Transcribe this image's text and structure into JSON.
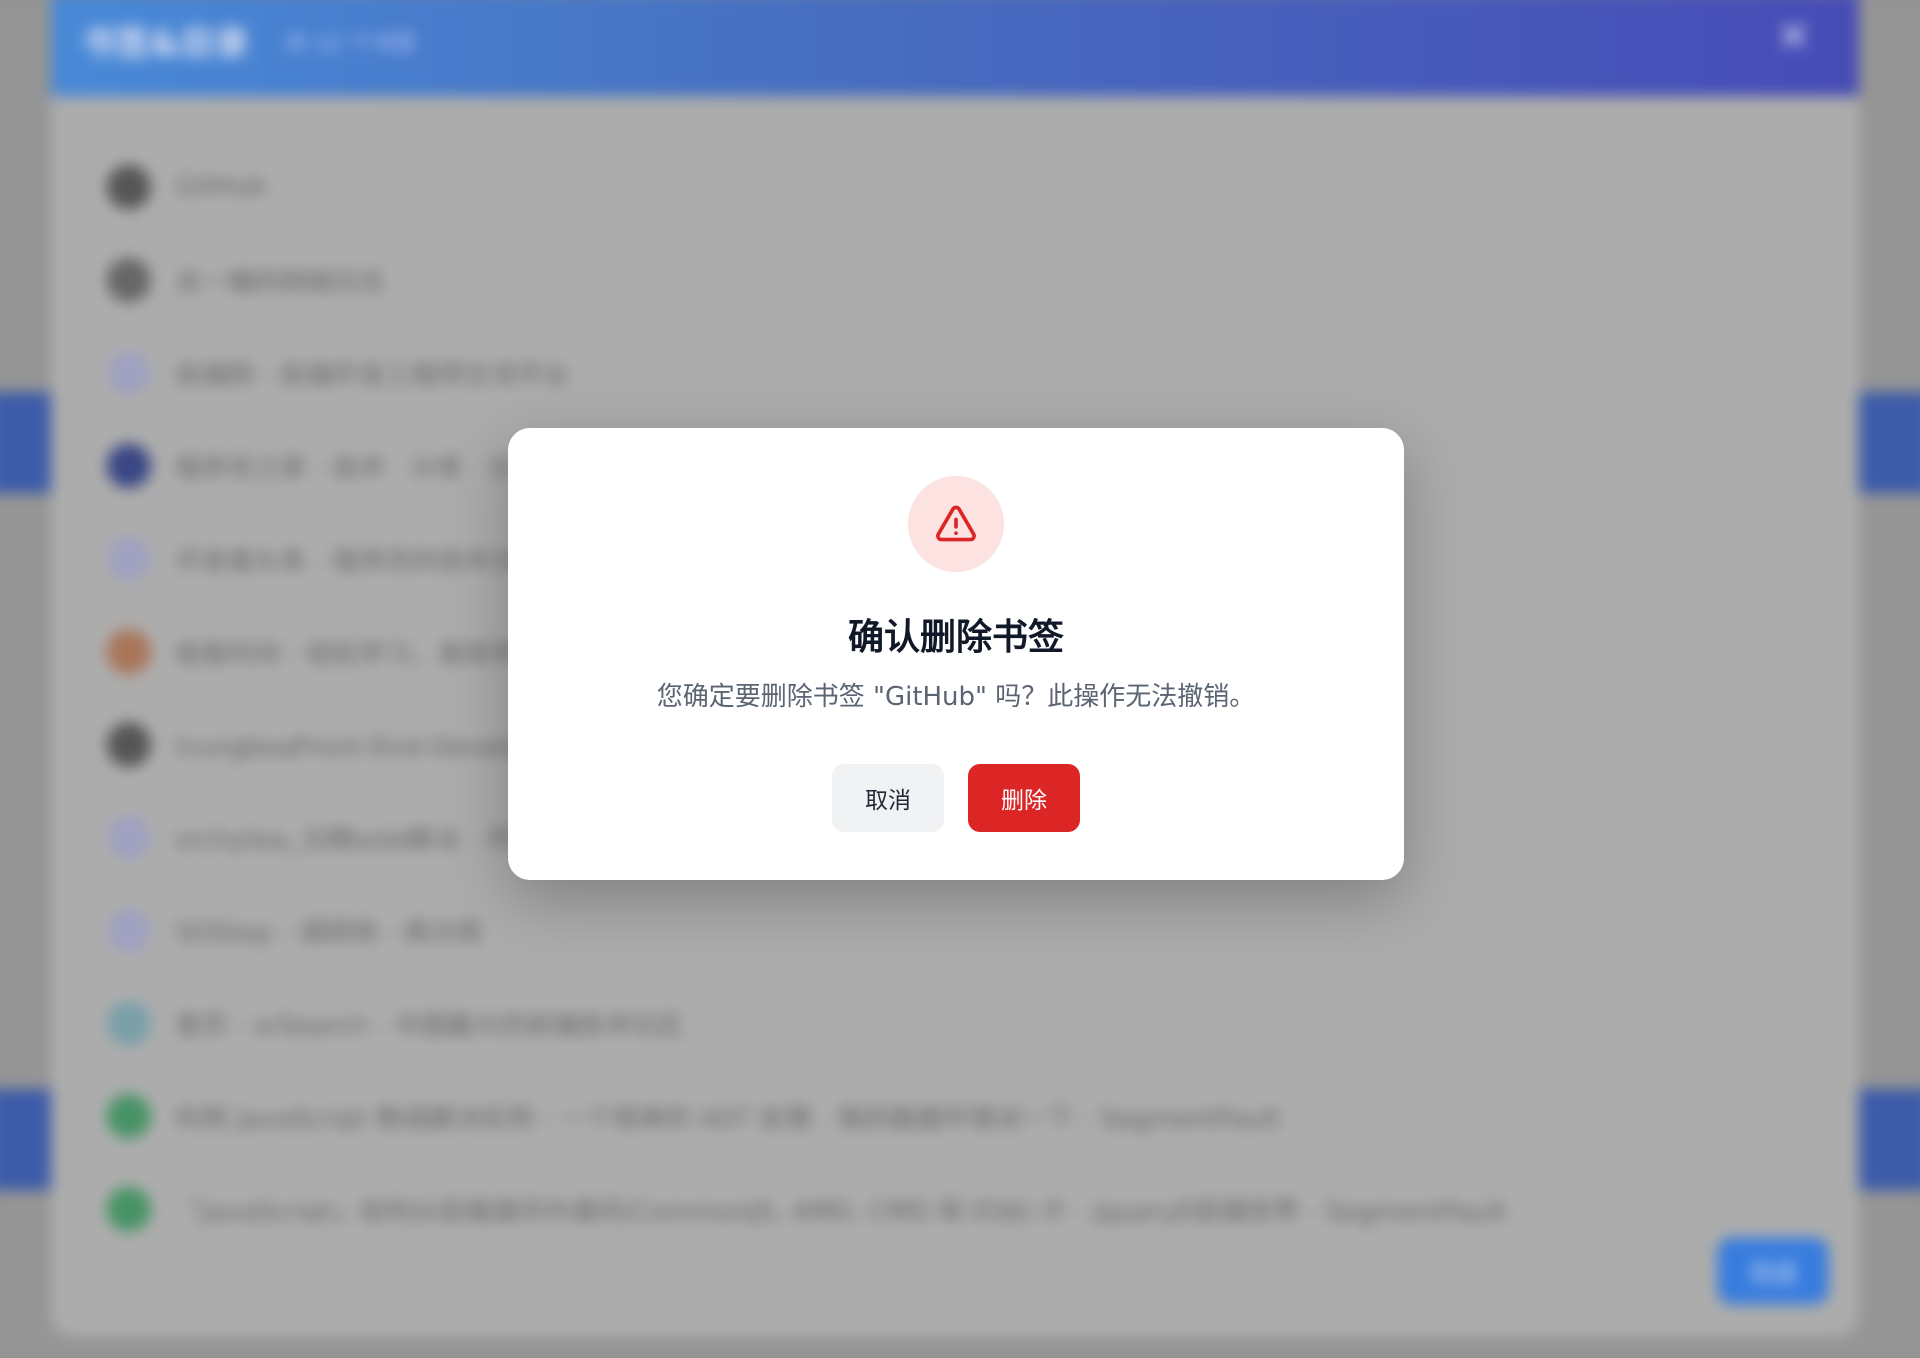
{
  "background": {
    "bookmark_manager": {
      "title": "书签&目录",
      "count": "共 12 个书签",
      "close_icon": "close-icon",
      "done_label": "完成",
      "bookmarks": [
        {
          "title": "GitHub",
          "favicon_color": "#5a5a5a"
        },
        {
          "title": "去一桶的网络日志",
          "favicon_color": "#6b6b6b"
        },
        {
          "title": "前端网 - 前端开发工程师交流平台",
          "favicon_color": "#a6a8c8"
        },
        {
          "title": "程序员之家 - 技术 · 分享 · 交流",
          "favicon_color": "#3c4a8a"
        },
        {
          "title": "开发者头条 - 程序员的技术分享社区",
          "favicon_color": "#a6a8c8"
        },
        {
          "title": "极客时间 - 轻松学习，高效学习",
          "favicon_color": "#b07a5c"
        },
        {
          "title": "trungbeaFront-End-Developer-Interview-Questions: 前端开发面试题的中文翻译版本",
          "favicon_color": "#5a5a5a"
        },
        {
          "title": "srchytea_日期sole解法 - 开源",
          "favicon_color": "#a6a8c8"
        },
        {
          "title": "SOStep - 调研网 - 再次观",
          "favicon_color": "#a6a8c8"
        },
        {
          "title": "首页 - srSearch - 中国最大的前端技术社区",
          "favicon_color": "#7fa6b0"
        },
        {
          "title": "利用 JavaScript 数组解决实例 - 一个简单的 AST 处理 - 我的面面环境试一下 - SegmentFault",
          "favicon_color": "#4a9a6a"
        },
        {
          "title": "「JavaScript」如何从前端通讯中通讯(CommonJS, AMD, CMD 和 ES6) 片 - JqueryE前端世界 - SegmentFault",
          "favicon_color": "#4a9a6a"
        }
      ]
    }
  },
  "dialog": {
    "icon": "warning-triangle-icon",
    "icon_color": "#dc2626",
    "title": "确认删除书签",
    "message": "您确定要删除书签 \"GitHub\" 吗？此操作无法撤销。",
    "cancel_label": "取消",
    "delete_label": "删除",
    "delete_color": "#dc2626"
  }
}
